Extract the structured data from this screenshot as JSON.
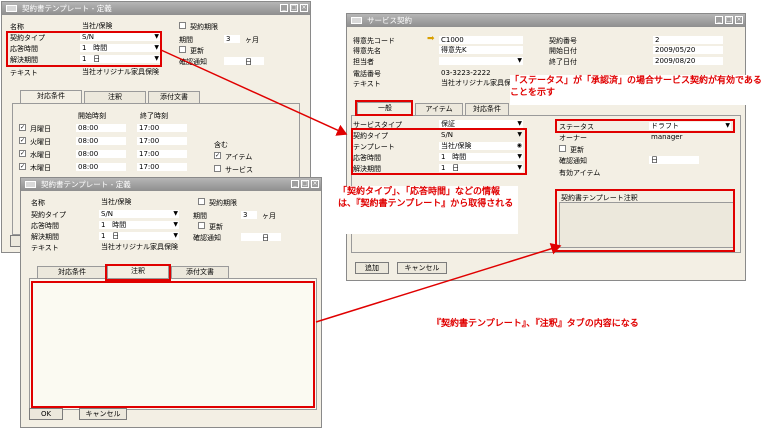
{
  "back_window": {
    "title": "契約書テンプレート - 定義",
    "fields": [
      {
        "label": "名称",
        "value": "当社/保険"
      },
      {
        "label": "契約タイプ",
        "value": "S/N"
      },
      {
        "label": "応答時間",
        "value": "1",
        "unit": "時間"
      },
      {
        "label": "解決期間",
        "value": "1",
        "unit": "日"
      },
      {
        "label": "テキスト",
        "value": "当社オリジナル家具保険"
      }
    ],
    "right_fields": {
      "keiyaku_kigen": "契約期限",
      "kikan_label": "期間",
      "kikan_value": "3",
      "kikan_unit": "ヶ月",
      "koushin": "更新",
      "kakunin_label": "確認通知",
      "kakunin_unit": "日"
    },
    "tabs": [
      "対応条件",
      "注釈",
      "添付文書"
    ],
    "col_start": "開始時刻",
    "col_end": "終了時刻",
    "days": [
      {
        "day": "月曜日",
        "start": "08:00",
        "end": "17:00"
      },
      {
        "day": "火曜日",
        "start": "08:00",
        "end": "17:00"
      },
      {
        "day": "水曜日",
        "start": "08:00",
        "end": "17:00"
      },
      {
        "day": "木曜日",
        "start": "08:00",
        "end": "17:00"
      }
    ],
    "includes_label": "含む",
    "include_items": [
      "アイテム",
      "サービス"
    ]
  },
  "front_window": {
    "title": "契約書テンプレート - 定義",
    "fields": [
      {
        "label": "名称",
        "value": "当社/保険"
      },
      {
        "label": "契約タイプ",
        "value": "S/N"
      },
      {
        "label": "応答時間",
        "value": "1",
        "unit": "時間"
      },
      {
        "label": "解決期間",
        "value": "1",
        "unit": "日"
      },
      {
        "label": "テキスト",
        "value": "当社オリジナル家具保険"
      }
    ],
    "right_fields": {
      "keiyaku_kigen": "契約期限",
      "kikan_label": "期間",
      "kikan_value": "3",
      "kikan_unit": "ヶ月",
      "koushin": "更新",
      "kakunin_label": "確認通知",
      "kakunin_unit": "日"
    },
    "tabs": [
      "対応条件",
      "注釈",
      "添付文書"
    ],
    "ok": "OK",
    "cancel": "キャンセル"
  },
  "service_window": {
    "title": "サービス契約",
    "left_fields": [
      {
        "label": "得意先コード",
        "value": "C1000"
      },
      {
        "label": "得意先名",
        "value": "得意先K"
      },
      {
        "label": "担当者",
        "value": ""
      },
      {
        "label": "電話番号",
        "value": "03-3223-2222"
      },
      {
        "label": "テキスト",
        "value": "当社オリジナル家具保険"
      }
    ],
    "right_fields": [
      {
        "label": "契約番号",
        "value": "2"
      },
      {
        "label": "開始日付",
        "value": "2009/05/20"
      },
      {
        "label": "終了日付",
        "value": "2009/08/20"
      }
    ],
    "tabs": [
      "一般",
      "アイテム",
      "対応条件"
    ],
    "general_left": [
      {
        "label": "サービスタイプ",
        "value": "保証"
      },
      {
        "label": "契約タイプ",
        "value": "S/N"
      },
      {
        "label": "テンプレート",
        "value": "当社/保険"
      },
      {
        "label": "応答時間",
        "value": "1",
        "unit": "時間"
      },
      {
        "label": "解決期間",
        "value": "1",
        "unit": "日"
      }
    ],
    "general_right": [
      {
        "label": "ステータス",
        "value": "ドラフト"
      },
      {
        "label": "オーナー",
        "value": "manager"
      },
      {
        "label": "更新",
        "value": ""
      },
      {
        "label": "確認通知",
        "value": "日"
      },
      {
        "label": "有効アイテム",
        "value": ""
      }
    ],
    "template_note_label": "契約書テンプレート注釈",
    "add": "追加",
    "cancel": "キャンセル"
  },
  "annotations": {
    "status_note": "「ステータス」が「承認済」の場合サービス契約が有効であることを示す",
    "info_note": "「契約タイプ」、「応答時間」などの情報は、『契約書テンプレート』から取得される",
    "remarks_note": "『契約書テンプレート』、『注釈』タブの内容になる"
  },
  "colors": {
    "annotation": "#e00000",
    "window_bg": "#f3efe4",
    "titlebar": "#9a9a9a"
  }
}
